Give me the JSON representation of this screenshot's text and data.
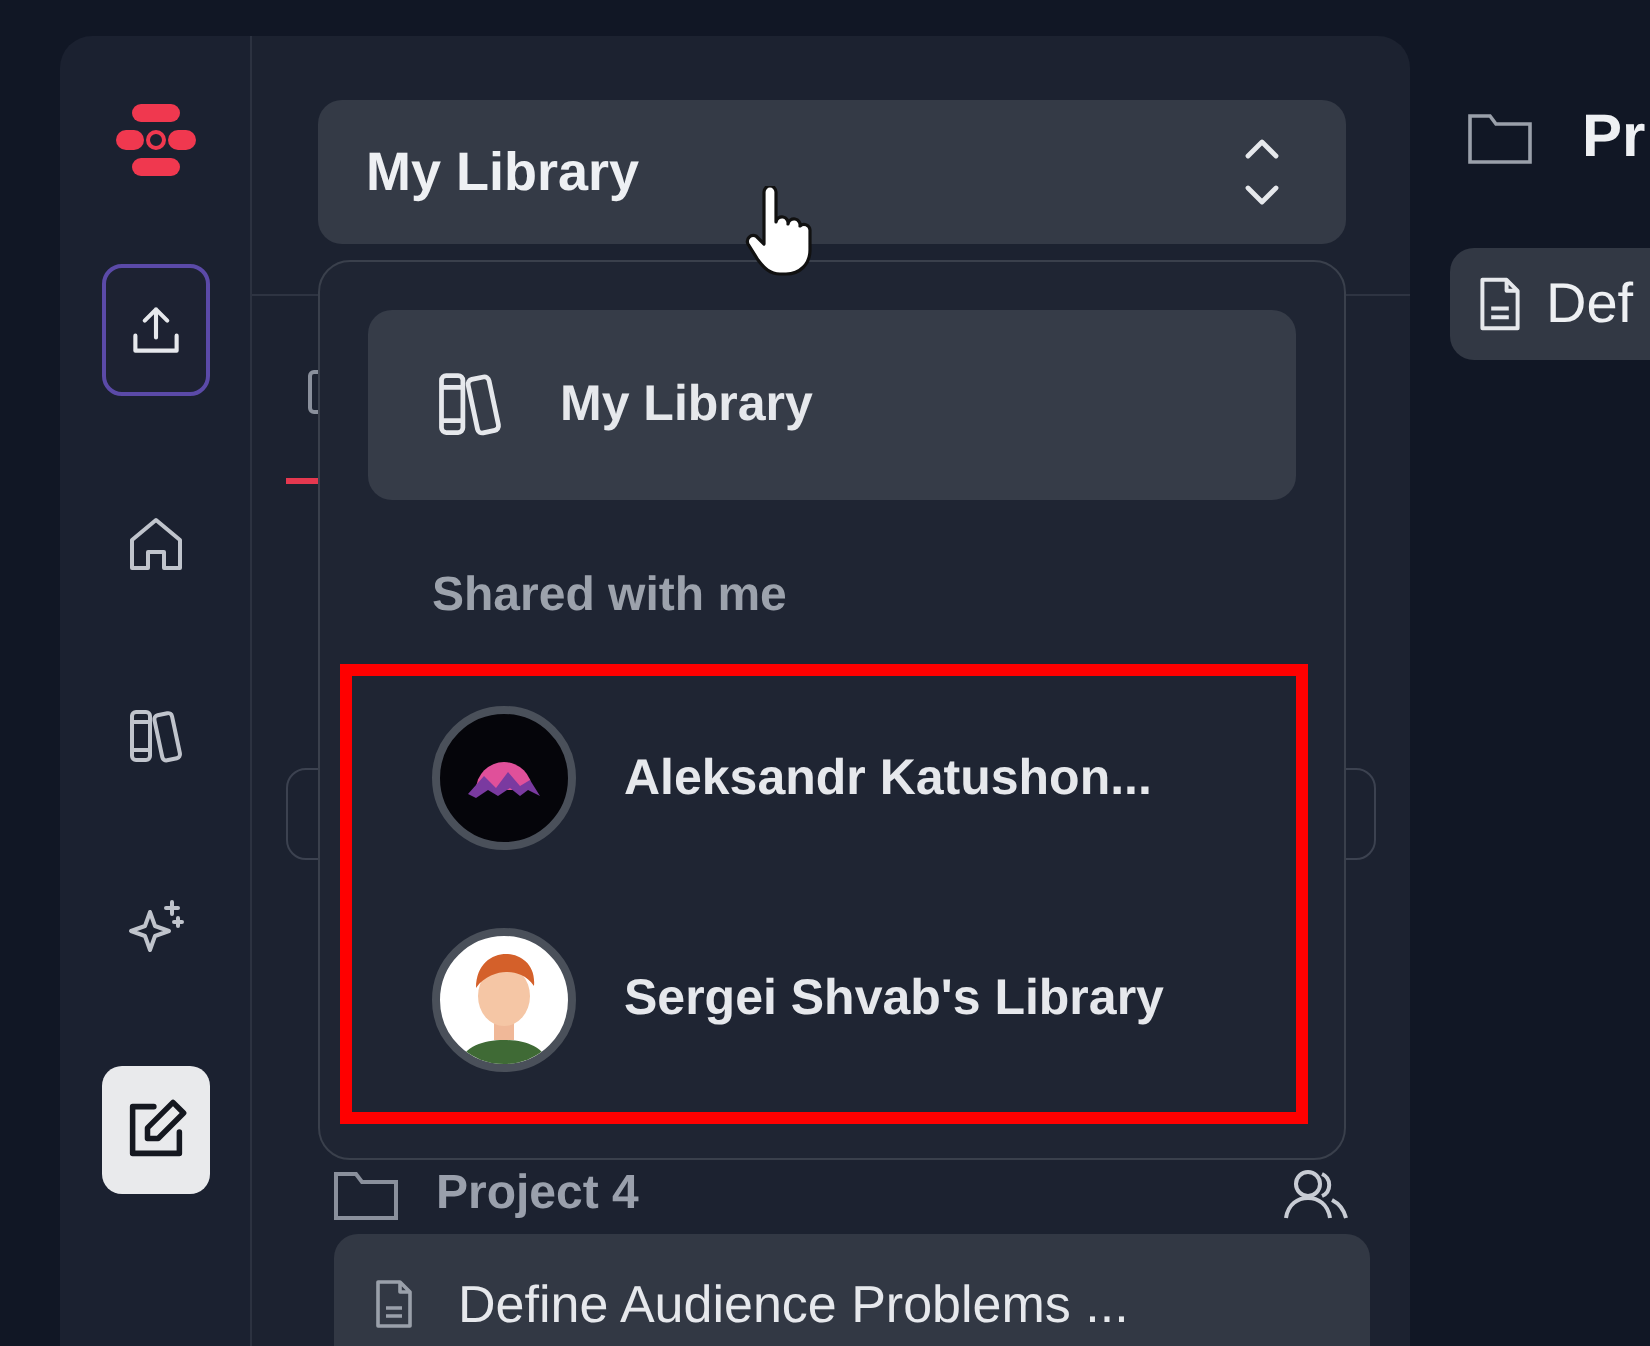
{
  "rail": {
    "buttons": [
      {
        "kind": "upload",
        "selected": false
      },
      {
        "kind": "home",
        "selected": false
      },
      {
        "kind": "library",
        "selected": false
      },
      {
        "kind": "ai",
        "selected": false
      },
      {
        "kind": "edit",
        "selected": true
      }
    ]
  },
  "library_select": {
    "value": "My Library",
    "open": true
  },
  "panel": {
    "tab_selected": true,
    "project": {
      "name": "Project 4",
      "shared": true
    },
    "document": {
      "title": "Define Audience Problems ...",
      "selected": true
    }
  },
  "dropdown": {
    "items": [
      {
        "label": "My Library",
        "selected": true
      }
    ],
    "section_label": "Shared with me",
    "shared": [
      {
        "label": "Aleksandr Katushon...",
        "kind": "mountain"
      },
      {
        "label": "Sergei Shvab's Library",
        "kind": "person"
      }
    ],
    "highlighted": true
  },
  "main": {
    "folder_title": "Pr",
    "document_chip": "Def"
  }
}
